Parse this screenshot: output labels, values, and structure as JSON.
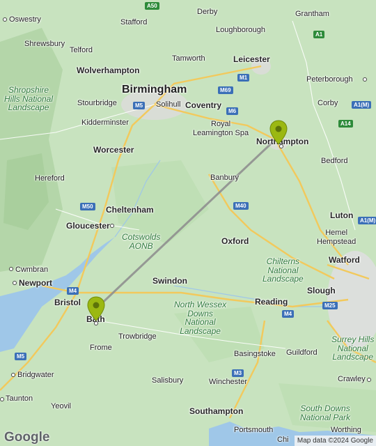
{
  "map": {
    "attribution": "Map data ©2024 Google",
    "logo": "Google",
    "colors": {
      "land": "#c9e4c0",
      "water": "#9fc7e8",
      "route": "#8f8f8f",
      "pin": "#9bb812",
      "motorway": "#f2c95c"
    },
    "route": {
      "from": "Bath",
      "to": "Northampton"
    },
    "places": [
      {
        "name": "Derby",
        "cls": ""
      },
      {
        "name": "Grantham",
        "cls": ""
      },
      {
        "name": "Oswestry",
        "cls": ""
      },
      {
        "name": "Stafford",
        "cls": ""
      },
      {
        "name": "Loughborough",
        "cls": ""
      },
      {
        "name": "Shrewsbury",
        "cls": ""
      },
      {
        "name": "Telford",
        "cls": ""
      },
      {
        "name": "Tamworth",
        "cls": ""
      },
      {
        "name": "Leicester",
        "cls": "mid"
      },
      {
        "name": "Wolverhampton",
        "cls": "mid"
      },
      {
        "name": "Birmingham",
        "cls": "big"
      },
      {
        "name": "Peterborough",
        "cls": ""
      },
      {
        "name": "Stourbridge",
        "cls": ""
      },
      {
        "name": "Solihull",
        "cls": ""
      },
      {
        "name": "Coventry",
        "cls": "mid"
      },
      {
        "name": "Corby",
        "cls": ""
      },
      {
        "name": "Kidderminster",
        "cls": ""
      },
      {
        "name": "Royal\nLeamington Spa",
        "cls": ""
      },
      {
        "name": "Northampton",
        "cls": "mid"
      },
      {
        "name": "Worcester",
        "cls": "mid"
      },
      {
        "name": "Bedford",
        "cls": ""
      },
      {
        "name": "Hereford",
        "cls": ""
      },
      {
        "name": "Banbury",
        "cls": ""
      },
      {
        "name": "Cheltenham",
        "cls": "mid"
      },
      {
        "name": "Luton",
        "cls": "mid"
      },
      {
        "name": "Gloucester",
        "cls": "mid"
      },
      {
        "name": "Hemel\nHempstead",
        "cls": ""
      },
      {
        "name": "Oxford",
        "cls": "mid"
      },
      {
        "name": "Cwmbran",
        "cls": ""
      },
      {
        "name": "Watford",
        "cls": "mid"
      },
      {
        "name": "Newport",
        "cls": "mid"
      },
      {
        "name": "Swindon",
        "cls": "mid"
      },
      {
        "name": "Slough",
        "cls": "mid"
      },
      {
        "name": "Bristol",
        "cls": "mid"
      },
      {
        "name": "Reading",
        "cls": "mid"
      },
      {
        "name": "Bath",
        "cls": "mid"
      },
      {
        "name": "Frome",
        "cls": ""
      },
      {
        "name": "Trowbridge",
        "cls": ""
      },
      {
        "name": "Basingstoke",
        "cls": ""
      },
      {
        "name": "Guildford",
        "cls": ""
      },
      {
        "name": "Bridgwater",
        "cls": ""
      },
      {
        "name": "Salisbury",
        "cls": ""
      },
      {
        "name": "Winchester",
        "cls": ""
      },
      {
        "name": "Crawley",
        "cls": ""
      },
      {
        "name": "Taunton",
        "cls": ""
      },
      {
        "name": "Yeovil",
        "cls": ""
      },
      {
        "name": "Southampton",
        "cls": "mid"
      },
      {
        "name": "Portsmouth",
        "cls": ""
      },
      {
        "name": "Worthing",
        "cls": ""
      },
      {
        "name": "Chi",
        "cls": ""
      }
    ],
    "parks": [
      "Shropshire\nHills National\nLandscape",
      "Cotswolds\nAONB",
      "Chilterns\nNational\nLandscape",
      "North Wessex\nDowns\nNational\nLandscape",
      "Surrey Hills\nNational\nLandscape",
      "South Downs\nNational Park"
    ],
    "roads": [
      "A50",
      "A1",
      "M5",
      "M69",
      "M1",
      "M6",
      "A1(M)",
      "A14",
      "M50",
      "M40",
      "A1(M)",
      "M4",
      "M4",
      "M25",
      "M5",
      "M3"
    ]
  }
}
